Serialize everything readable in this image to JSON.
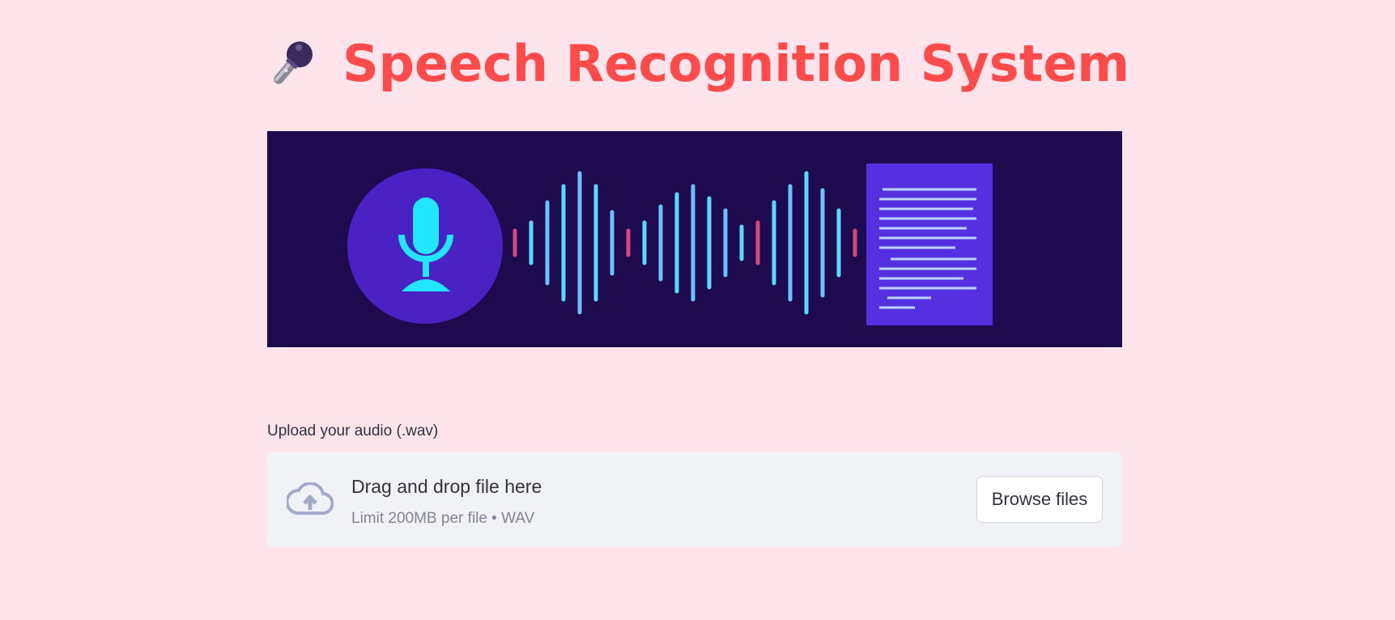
{
  "header": {
    "icon": "microphone-icon",
    "title": "Speech Recognition System"
  },
  "banner": {
    "image": "speech-to-text-illustration",
    "background_color": "#1e0a4e",
    "accent_color": "#ff4b4b"
  },
  "uploader": {
    "label": "Upload your audio (.wav)",
    "drop_text": "Drag and drop file here",
    "limit_text": "Limit 200MB per file • WAV",
    "browse_label": "Browse files",
    "icon": "cloud-upload-icon"
  }
}
